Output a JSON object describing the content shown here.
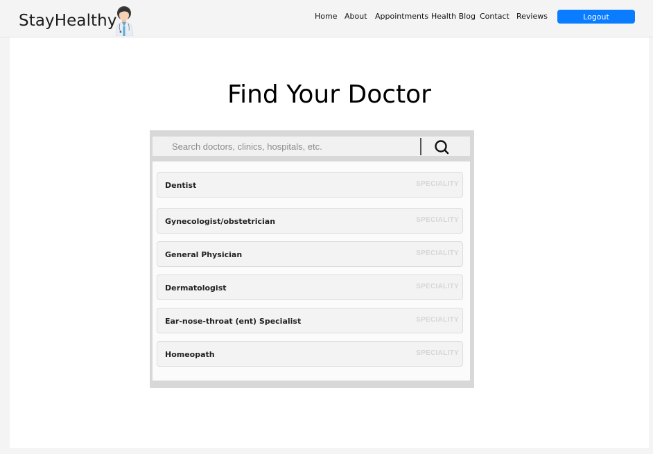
{
  "brand": {
    "name": "StayHealthy",
    "logo_icon": "doctor-avatar-icon"
  },
  "nav": {
    "links": [
      "Home",
      "About",
      "Appointments",
      "Health Blog",
      "Contact",
      "Reviews"
    ],
    "logout_label": "Logout",
    "accent_color": "#0a7cff"
  },
  "page": {
    "title": "Find Your Doctor"
  },
  "search": {
    "placeholder": "Search doctors, clinics, hospitals, etc.",
    "value": "",
    "button_icon": "search-icon"
  },
  "results": [
    {
      "name": "Dentist",
      "tag": "SPECIALITY"
    },
    {
      "name": "Gynecologist/obstetrician",
      "tag": "SPECIALITY"
    },
    {
      "name": "General Physician",
      "tag": "SPECIALITY"
    },
    {
      "name": "Dermatologist",
      "tag": "SPECIALITY"
    },
    {
      "name": "Ear-nose-throat (ent) Specialist",
      "tag": "SPECIALITY"
    },
    {
      "name": "Homeopath",
      "tag": "SPECIALITY"
    }
  ]
}
